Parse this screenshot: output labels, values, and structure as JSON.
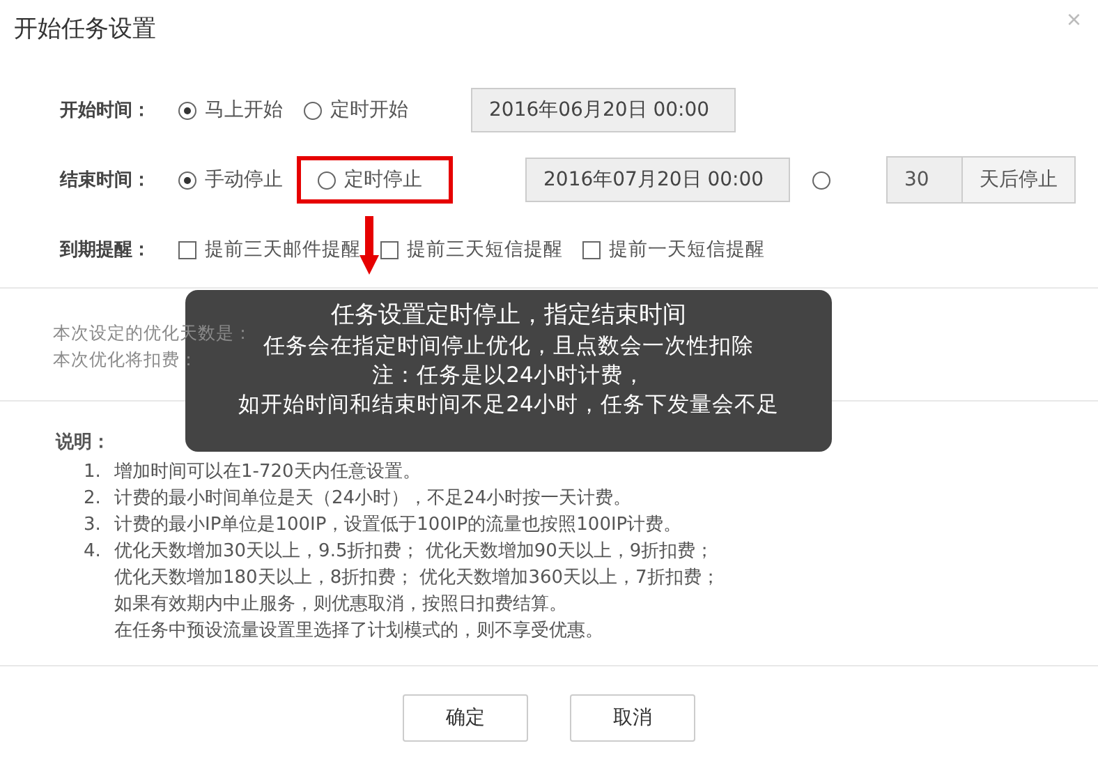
{
  "dialog": {
    "title": "开始任务设置",
    "close": "×"
  },
  "start": {
    "label": "开始时间：",
    "options": [
      {
        "label": "马上开始",
        "selected": true
      },
      {
        "label": "定时开始",
        "selected": false
      }
    ],
    "date": "2016年06月20日 00:00"
  },
  "end": {
    "label": "结束时间：",
    "options": [
      {
        "label": "手动停止",
        "selected": true,
        "highlighted": false
      },
      {
        "label": "定时停止",
        "selected": false,
        "highlighted": true
      }
    ],
    "date": "2016年07月20日 00:00",
    "days_option": {
      "selected": false
    },
    "days": "30",
    "days_suffix": "天后停止"
  },
  "reminder": {
    "label": "到期提醒：",
    "options": [
      {
        "label": "提前三天邮件提醒",
        "checked": false
      },
      {
        "label": "提前三天短信提醒",
        "checked": false
      },
      {
        "label": "提前一天短信提醒",
        "checked": false
      }
    ]
  },
  "summary": [
    "本次设定的优化天数是：",
    "本次优化将扣费："
  ],
  "tooltip": [
    "任务设置定时停止，指定结束时间",
    "任务会在指定时间停止优化，且点数会一次性扣除",
    "注：任务是以24小时计费，",
    "如开始时间和结束时间不足24小时，任务下发量会不足"
  ],
  "notes": {
    "heading": "说明：",
    "items": [
      {
        "number": "1.",
        "lines": [
          "增加时间可以在1-720天内任意设置。"
        ]
      },
      {
        "number": "2.",
        "lines": [
          "计费的最小时间单位是天（24小时），不足24小时按一天计费。"
        ]
      },
      {
        "number": "3.",
        "lines": [
          "计费的最小IP单位是100IP，设置低于100IP的流量也按照100IP计费。"
        ]
      },
      {
        "number": "4.",
        "lines": [
          "优化天数增加30天以上，9.5折扣费； 优化天数增加90天以上，9折扣费；",
          "优化天数增加180天以上，8折扣费； 优化天数增加360天以上，7折扣费；",
          "如果有效期内中止服务，则优惠取消，按照日扣费结算。",
          "在任务中预设流量设置里选择了计划模式的，则不享受优惠。"
        ]
      }
    ]
  },
  "buttons": [
    "确定",
    "取消"
  ]
}
